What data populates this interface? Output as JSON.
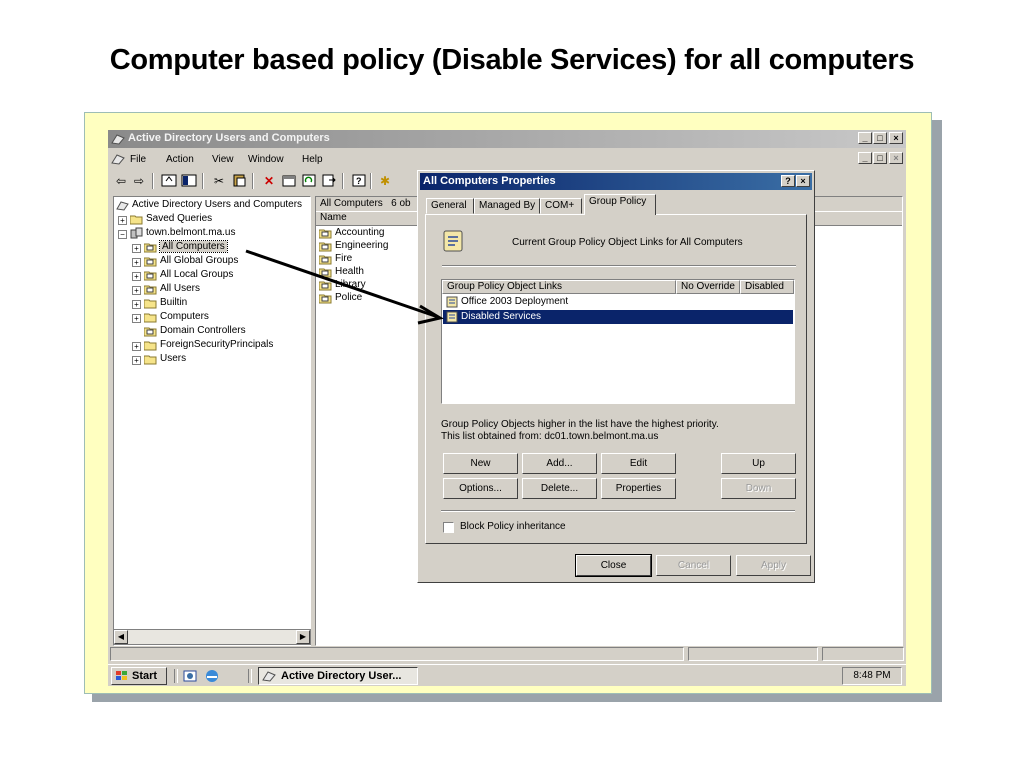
{
  "slide": {
    "title": "Computer based policy (Disable Services) for all computers"
  },
  "window": {
    "title": "Active Directory Users and Computers",
    "caption_buttons": [
      "_",
      "□",
      "×"
    ],
    "menu": [
      "File",
      "Action",
      "View",
      "Window",
      "Help"
    ]
  },
  "tree": {
    "root": "Active Directory Users and Computers",
    "items": [
      {
        "label": "Saved Queries",
        "icon": "folder-icon"
      },
      {
        "label": "town.belmont.ma.us",
        "icon": "domain-icon"
      },
      {
        "label": "All Computers",
        "icon": "ou-icon"
      },
      {
        "label": "All Global Groups",
        "icon": "ou-icon"
      },
      {
        "label": "All Local Groups",
        "icon": "ou-icon"
      },
      {
        "label": "All Users",
        "icon": "ou-icon"
      },
      {
        "label": "Builtin",
        "icon": "folder-icon"
      },
      {
        "label": "Computers",
        "icon": "folder-icon"
      },
      {
        "label": "Domain Controllers",
        "icon": "ou-icon"
      },
      {
        "label": "ForeignSecurityPrincipals",
        "icon": "folder-icon"
      },
      {
        "label": "Users",
        "icon": "folder-icon"
      }
    ]
  },
  "right_pane": {
    "header": "All Computers   6 ob",
    "column": "Name",
    "items": [
      "Accounting",
      "Engineering",
      "Fire",
      "Health",
      "Library",
      "Police"
    ]
  },
  "dialog": {
    "title": "All Computers Properties",
    "tabs": [
      "General",
      "Managed By",
      "COM+",
      "Group Policy"
    ],
    "active_tab": "Group Policy",
    "heading": "Current Group Policy Object Links for All Computers",
    "list_columns": [
      "Group Policy Object Links",
      "No Override",
      "Disabled"
    ],
    "list_rows": [
      "Office 2003 Deployment",
      "Disabled Services"
    ],
    "selected_row": "Disabled Services",
    "note_line1": "Group Policy Objects higher in the list have the highest priority.",
    "note_line2": "This list obtained from: dc01.town.belmont.ma.us",
    "buttons": {
      "new": "New",
      "add": "Add...",
      "edit": "Edit",
      "up": "Up",
      "options": "Options...",
      "delete": "Delete...",
      "properties": "Properties",
      "down": "Down"
    },
    "block_inheritance": "Block Policy inheritance",
    "footer": {
      "close": "Close",
      "cancel": "Cancel",
      "apply": "Apply"
    }
  },
  "taskbar": {
    "start": "Start",
    "task": "Active Directory User...",
    "clock": "8:48 PM"
  },
  "colors": {
    "selection": "#0a246a",
    "dialog_title": "#0a246a",
    "frame_bg": "#ffffc0"
  }
}
